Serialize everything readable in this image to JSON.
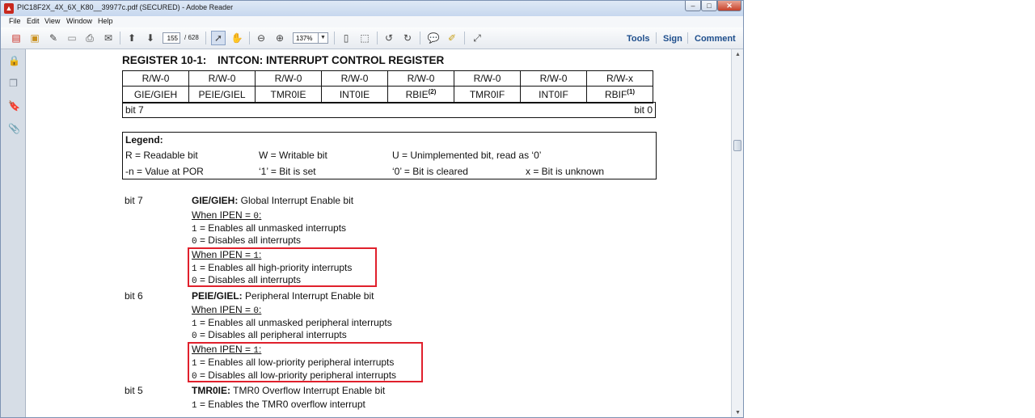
{
  "window": {
    "title": "PIC18F2X_4X_6X_K80__39977c.pdf (SECURED) - Adobe Reader",
    "controls": {
      "minimize": "–",
      "maximize": "□",
      "close": "✕"
    }
  },
  "menu": [
    "File",
    "Edit",
    "View",
    "Window",
    "Help"
  ],
  "toolbar": {
    "page_current": "155",
    "page_total": "/ 628",
    "zoom": "137%",
    "links": {
      "tools": "Tools",
      "sign": "Sign",
      "comment": "Comment"
    }
  },
  "colors": {
    "highlight_box": "#e0202c",
    "link": "#1e4e8c"
  },
  "document": {
    "register_label": "REGISTER 10-1:",
    "register_name": "INTCON: INTERRUPT CONTROL REGISTER",
    "access": [
      "R/W-0",
      "R/W-0",
      "R/W-0",
      "R/W-0",
      "R/W-0",
      "R/W-0",
      "R/W-0",
      "R/W-x"
    ],
    "bit_names": [
      "GIE/GIEH",
      "PEIE/GIEL",
      "TMR0IE",
      "INT0IE",
      "RBIE",
      "TMR0IF",
      "INT0IF",
      "RBIF"
    ],
    "bit_name_notes": {
      "rbie": "(2)",
      "rbif": "(1)"
    },
    "bit_high": "bit 7",
    "bit_low": "bit 0",
    "legend": {
      "title": "Legend:",
      "readable": "R = Readable bit",
      "writable": "W = Writable bit",
      "unimplemented": "U = Unimplemented bit, read as ‘0’",
      "por": "-n = Value at POR",
      "set": "‘1’ = Bit is set",
      "cleared": "‘0’ = Bit is cleared",
      "unknown": "x = Bit is unknown"
    },
    "bit7": {
      "label": "bit 7",
      "name": "GIE/GIEH:",
      "title": " Global Interrupt Enable bit",
      "when0": "When IPEN = ",
      "when0_val": "0",
      "one_a": "1",
      "one_a_text": " = Enables all unmasked interrupts",
      "zero_a": "0",
      "zero_a_text": " = Disables all interrupts",
      "when1": "When IPEN = ",
      "when1_val": "1",
      "one_b": "1",
      "one_b_text": " = Enables all high-priority interrupts",
      "zero_b": "0",
      "zero_b_text": " = Disables all interrupts"
    },
    "bit6": {
      "label": "bit 6",
      "name": "PEIE/GIEL:",
      "title": " Peripheral Interrupt Enable bit",
      "when0": "When IPEN = ",
      "when0_val": "0",
      "one_a": "1",
      "one_a_text": " = Enables all unmasked peripheral interrupts",
      "zero_a": "0",
      "zero_a_text": " = Disables all peripheral interrupts",
      "when1": "When IPEN = ",
      "when1_val": "1",
      "one_b": "1",
      "one_b_text": " = Enables all low-priority peripheral interrupts",
      "zero_b": "0",
      "zero_b_text": " = Disables all low-priority peripheral interrupts"
    },
    "bit5": {
      "label": "bit 5",
      "name": "TMR0IE:",
      "title": " TMR0 Overflow Interrupt Enable bit",
      "one_a": "1",
      "one_a_text": " = Enables the TMR0 overflow interrupt"
    }
  }
}
